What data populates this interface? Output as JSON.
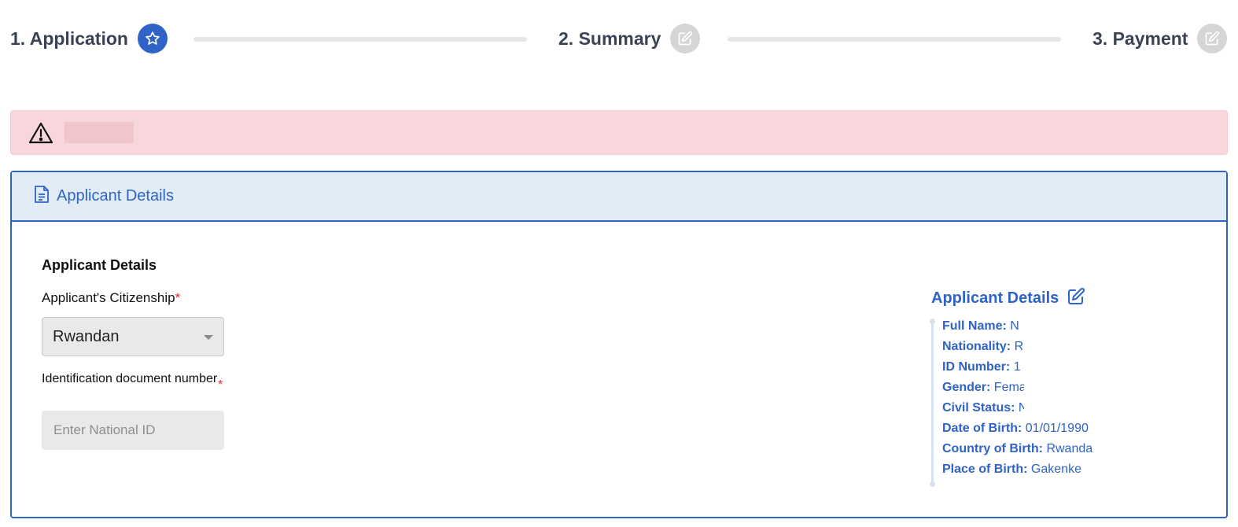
{
  "stepper": {
    "steps": [
      {
        "label": "1. Application",
        "state": "active",
        "icon": "star-icon"
      },
      {
        "label": "2. Summary",
        "state": "inactive",
        "icon": "edit-icon"
      },
      {
        "label": "3. Payment",
        "state": "inactive",
        "icon": "edit-icon"
      }
    ]
  },
  "alert": {
    "icon": "warning-icon",
    "text": ""
  },
  "panel": {
    "header_title": "Applicant Details",
    "header_icon": "document-icon"
  },
  "form": {
    "heading": "Applicant Details",
    "citizenship_label": "Applicant's Citizenship",
    "required_mark": "*",
    "citizenship_value": "Rwandan",
    "id_label": "Identification document number",
    "id_placeholder": "Enter National ID",
    "id_value": ""
  },
  "summary": {
    "title": "Applicant Details",
    "edit_icon": "edit-icon",
    "items": [
      {
        "key": "Full Name:",
        "value": "N"
      },
      {
        "key": "Nationality:",
        "value": "R"
      },
      {
        "key": "ID Number:",
        "value": "1"
      },
      {
        "key": "Gender:",
        "value": "Fema"
      },
      {
        "key": "Civil Status:",
        "value": "N"
      },
      {
        "key": "Date of Birth:",
        "value": "01/01/1990"
      },
      {
        "key": "Country of Birth:",
        "value": "Rwanda"
      },
      {
        "key": "Place of Birth:",
        "value": "Gakenke"
      }
    ]
  },
  "colors": {
    "accent": "#2f63c7",
    "alert_bg": "#f8d7dc",
    "header_bg": "#e2ecf7",
    "required": "#d9253a"
  }
}
